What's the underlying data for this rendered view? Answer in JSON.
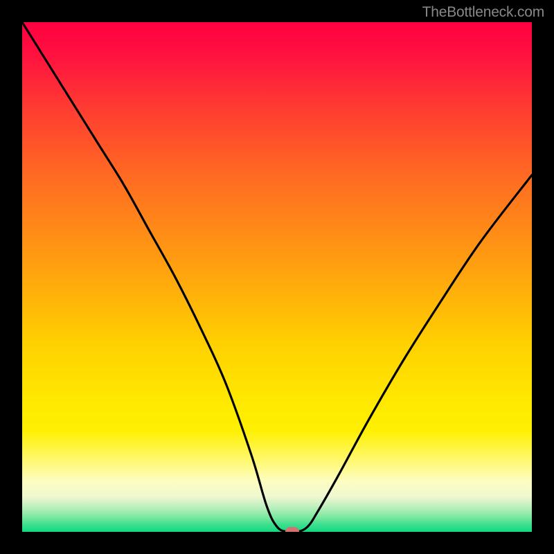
{
  "watermark": "TheBottleneck.com",
  "chart_data": {
    "type": "line",
    "title": "",
    "xlabel": "",
    "ylabel": "",
    "xlim": [
      0,
      100
    ],
    "ylim": [
      0,
      100
    ],
    "series": [
      {
        "name": "bottleneck-curve",
        "x": [
          0,
          5,
          10,
          15,
          20,
          25,
          30,
          35,
          40,
          45,
          48,
          50,
          52,
          54,
          56,
          58,
          62,
          68,
          75,
          82,
          90,
          100
        ],
        "values": [
          100,
          92,
          84,
          76,
          68,
          59,
          50,
          40,
          29,
          15,
          5,
          1,
          0,
          0,
          1,
          4,
          11,
          22,
          34,
          45,
          57,
          70
        ]
      }
    ],
    "marker": {
      "x": 53,
      "y": 0,
      "color": "#d97070"
    },
    "background": "red-yellow-green-vertical-gradient"
  }
}
